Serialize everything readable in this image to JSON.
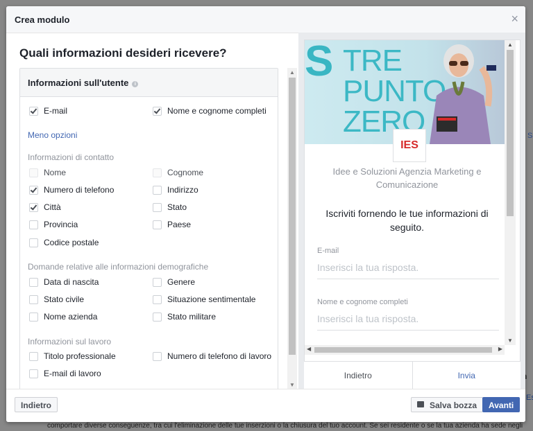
{
  "background": {
    "bottom_text": "comportare diverse conseguenze, tra cui l'eliminazione delle tue inserzioni o la chiusura del tuo account. Se sei residente o se la tua azienda ha sede negli",
    "right_text_a": "n",
    "right_text_b": "Es",
    "right_text_c": "S"
  },
  "dialog": {
    "title": "Crea modulo",
    "close_symbol": "×"
  },
  "left": {
    "heading": "Quali informazioni desideri ricevere?",
    "card_title": "Informazioni sull'utente",
    "info_symbol": "i",
    "primary_options": [
      {
        "label": "E-mail",
        "checked": true
      },
      {
        "label": "Nome e cognome completi",
        "checked": true
      }
    ],
    "less_options_link": "Meno opzioni",
    "contact_section": "Informazioni di contatto",
    "contact_options": [
      {
        "label": "Nome",
        "checked": false,
        "disabled": true
      },
      {
        "label": "Cognome",
        "checked": false,
        "disabled": true
      },
      {
        "label": "Numero di telefono",
        "checked": true
      },
      {
        "label": "Indirizzo",
        "checked": false
      },
      {
        "label": "Città",
        "checked": true
      },
      {
        "label": "Stato",
        "checked": false
      },
      {
        "label": "Provincia",
        "checked": false
      },
      {
        "label": "Paese",
        "checked": false
      },
      {
        "label": "Codice postale",
        "checked": false
      }
    ],
    "demographic_section": "Domande relative alle informazioni demografiche",
    "demographic_options": [
      {
        "label": "Data di nascita",
        "checked": false
      },
      {
        "label": "Genere",
        "checked": false
      },
      {
        "label": "Stato civile",
        "checked": false
      },
      {
        "label": "Situazione sentimentale",
        "checked": false
      },
      {
        "label": "Nome azienda",
        "checked": false
      },
      {
        "label": "Stato militare",
        "checked": false
      }
    ],
    "work_section": "Informazioni sul lavoro",
    "work_options": [
      {
        "label": "Titolo professionale",
        "checked": false
      },
      {
        "label": "Numero di telefono di lavoro",
        "checked": false
      },
      {
        "label": "E-mail di lavoro",
        "checked": false
      }
    ]
  },
  "preview": {
    "banner_s": "S",
    "banner_lines": [
      "TRE",
      "PUNTO",
      "ZERO"
    ],
    "logo_text": "IES",
    "company_name": "Idee e Soluzioni Agenzia Marketing e Comunicazione",
    "intro": "Iscriviti fornendo le tue informazioni di seguito.",
    "fields": [
      {
        "label": "E-mail",
        "placeholder": "Inserisci la tua risposta."
      },
      {
        "label": "Nome e cognome completi",
        "placeholder": "Inserisci la tua risposta."
      }
    ],
    "back_label": "Indietro",
    "send_label": "Invia"
  },
  "footer": {
    "back_label": "Indietro",
    "draft_label": "Salva bozza",
    "next_label": "Avanti"
  },
  "colors": {
    "accent": "#4267b2",
    "banner_teal": "#3cb8c5",
    "logo_red": "#d62a2a"
  }
}
